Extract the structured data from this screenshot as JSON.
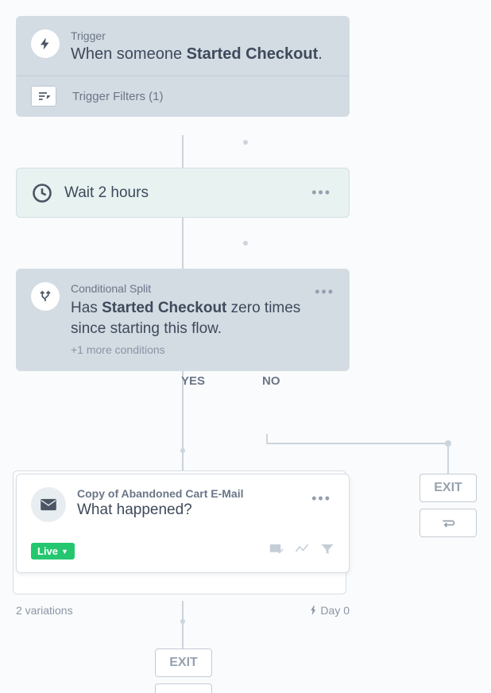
{
  "trigger": {
    "label": "Trigger",
    "prefix": "When someone ",
    "event": "Started Checkout",
    "suffix": ".",
    "filters_label": "Trigger Filters (1)"
  },
  "wait": {
    "text": "Wait 2 hours"
  },
  "split": {
    "label": "Conditional Split",
    "desc_prefix": "Has ",
    "desc_event": "Started Checkout",
    "desc_suffix": " zero times since starting this flow.",
    "more": "+1 more conditions",
    "yes": "YES",
    "no": "NO"
  },
  "email": {
    "name": "Copy of Abandoned Cart E-Mail",
    "subject": "What happened?",
    "status": "Live",
    "variations": "2 variations",
    "day": "Day 0"
  },
  "exit": {
    "label": "EXIT"
  }
}
